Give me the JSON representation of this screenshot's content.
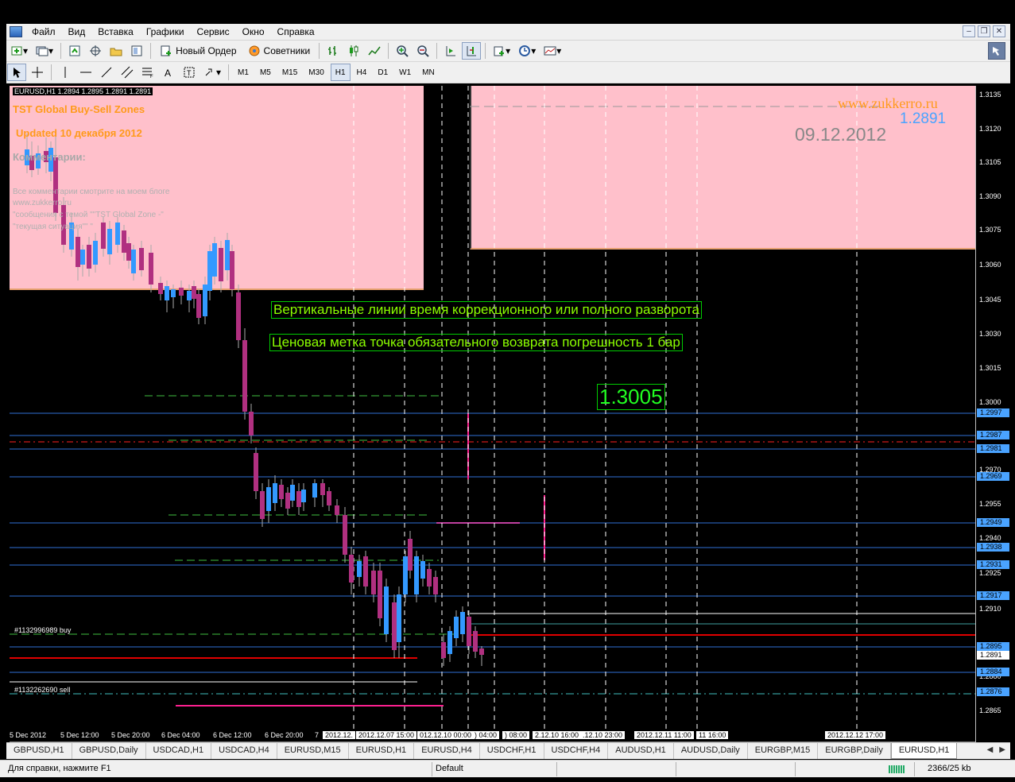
{
  "menu": {
    "items": [
      "Файл",
      "Вид",
      "Вставка",
      "Графики",
      "Сервис",
      "Окно",
      "Справка"
    ]
  },
  "toolbar": {
    "new_order_label": "Новый Ордер",
    "advisors_label": "Советники"
  },
  "timeframes": [
    "M1",
    "M5",
    "M15",
    "M30",
    "H1",
    "H4",
    "D1",
    "W1",
    "MN"
  ],
  "active_timeframe": "H1",
  "chart": {
    "header": "EURUSD,H1  1.2894 1.2895 1.2891 1.2891",
    "zone_title": "TST Global Buy-Sell Zones",
    "updated": "Updated  10 декабря 2012",
    "comments_title": "Комментарии:",
    "comments_lines": [
      "Все комментарии смотрите на моем блоге",
      "www.zukkerro.ru",
      "\"сообщения с темой \"\"TST Global Zone -\"",
      "\"текущая ситуация\"\" \""
    ],
    "site": "www.zukkerro.ru",
    "bid_label": "1.2891",
    "date_label": "09.12.2012",
    "note_vertical": "Вертикальные линии время коррекционного или полного разворота",
    "note_price": "Ценовая метка точка обязательного возврата  погрешность 1 бар",
    "price_mark": "1.3005",
    "order_buy": "#1132996989 buy",
    "order_sell": "#1132262690 sell"
  },
  "price_axis": {
    "labels": [
      "1.3135",
      "1.3120",
      "1.3105",
      "1.3090",
      "1.3075",
      "1.3060",
      "1.3045",
      "1.3030",
      "1.3015",
      "1.3000",
      "1.2985",
      "1.2970",
      "1.2955",
      "1.2940",
      "1.2925",
      "1.2910",
      "1.2880",
      "1.2865"
    ],
    "tags": [
      {
        "text": "1.2997",
        "color": "#4aa3ff"
      },
      {
        "text": "1.2987",
        "color": "#4aa3ff"
      },
      {
        "text": "1.2981",
        "color": "#4aa3ff"
      },
      {
        "text": "1.2969",
        "color": "#4aa3ff"
      },
      {
        "text": "1.2949",
        "color": "#4aa3ff"
      },
      {
        "text": "1.2938",
        "color": "#4aa3ff"
      },
      {
        "text": "1.2931",
        "color": "#4aa3ff"
      },
      {
        "text": "1.2917",
        "color": "#4aa3ff"
      },
      {
        "text": "1.2895",
        "color": "#4aa3ff"
      },
      {
        "text": "1.2891",
        "color": "#ffffff"
      },
      {
        "text": "1.2884",
        "color": "#4aa3ff"
      },
      {
        "text": "1.2876",
        "color": "#4aa3ff"
      }
    ]
  },
  "time_axis": {
    "labels": [
      "5 Dec 2012",
      "5 Dec 12:00",
      "5 Dec 20:00",
      "6 Dec 04:00",
      "6 Dec 12:00",
      "6 Dec 20:00",
      "7"
    ],
    "tags": [
      "2012.12.",
      "2012.12.07 15:00",
      "012.12.10 00:00",
      ") 04:00",
      ") 08:00",
      "2.12.10 16:00",
      ".12.10 23:00",
      "2012.12.11 11:00",
      "11 16:00",
      "2012.12.12 17:00"
    ]
  },
  "tabs": [
    "GBPUSD,H1",
    "GBPUSD,Daily",
    "USDCAD,H1",
    "USDCAD,H4",
    "EURUSD,M15",
    "EURUSD,H1",
    "EURUSD,H4",
    "USDCHF,H1",
    "USDCHF,H4",
    "AUDUSD,H1",
    "AUDUSD,Daily",
    "EURGBP,M15",
    "EURGBP,Daily",
    "EURUSD,H1"
  ],
  "active_tab_index": 13,
  "status": {
    "help": "Для справки, нажмите F1",
    "profile": "Default",
    "connection": "2366/25 kb"
  },
  "colors": {
    "zone_pink": "#ffc0cb",
    "bull": "#3399ff",
    "bear": "#b03080",
    "level_blue": "#2f6fd6",
    "level_red": "#e00000",
    "note_green": "#8cff00"
  }
}
